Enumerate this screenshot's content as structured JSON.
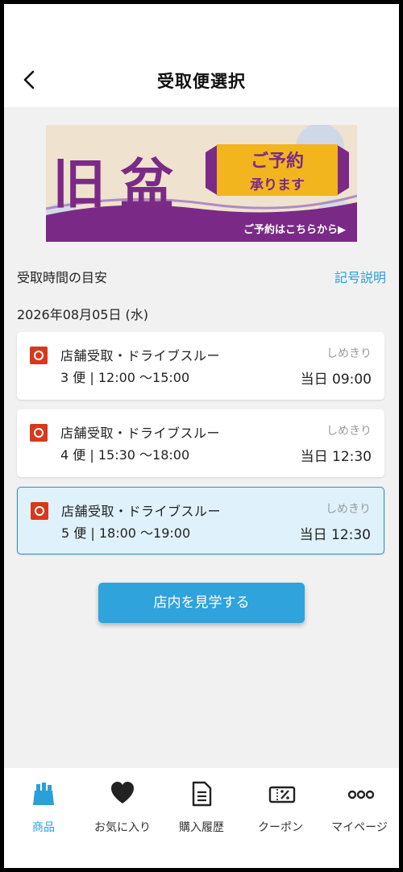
{
  "header": {
    "title": "受取便選択"
  },
  "banner": {
    "title_char1": "旧",
    "title_char2": "盆",
    "ribbon_line1": "ご予約",
    "ribbon_line2": "承ります",
    "cta": "ご予約はこちらから▶"
  },
  "section": {
    "label": "受取時間の目安",
    "legend_link": "記号説明"
  },
  "date": "2026年08月05日 (水)",
  "slots": [
    {
      "name": "店舗受取・ドライブスルー",
      "time": "3 便 | 12:00 〜15:00",
      "deadline_label": "しめきり",
      "deadline": "当日 09:00",
      "selected": false
    },
    {
      "name": "店舗受取・ドライブスルー",
      "time": "4 便 | 15:30 〜18:00",
      "deadline_label": "しめきり",
      "deadline": "当日 12:30",
      "selected": false
    },
    {
      "name": "店舗受取・ドライブスルー",
      "time": "5 便 | 18:00 〜19:00",
      "deadline_label": "しめきり",
      "deadline": "当日 12:30",
      "selected": true
    }
  ],
  "tour_button": "店内を見学する",
  "tabs": [
    {
      "label": "商品",
      "icon": "products-icon",
      "active": true
    },
    {
      "label": "お気に入り",
      "icon": "heart-icon",
      "active": false
    },
    {
      "label": "購入履歴",
      "icon": "document-icon",
      "active": false
    },
    {
      "label": "クーポン",
      "icon": "coupon-icon",
      "active": false
    },
    {
      "label": "マイページ",
      "icon": "more-icon",
      "active": false
    }
  ],
  "colors": {
    "accent": "#2a9fd8",
    "badge": "#d8381c",
    "banner_purple": "#7b2a86",
    "ribbon_gold": "#f2b51e"
  }
}
